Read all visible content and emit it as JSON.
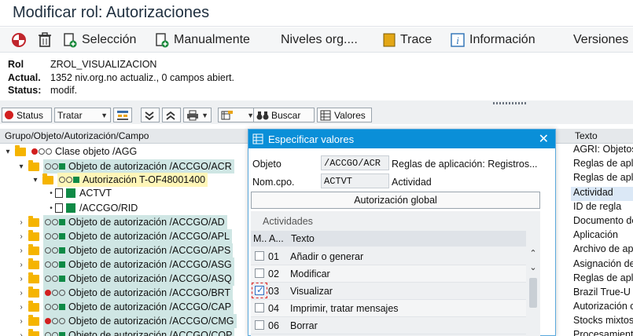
{
  "title": "Modificar rol: Autorizaciones",
  "toolbar": {
    "seleccion": "Selección",
    "manualmente": "Manualmente",
    "niveles": "Niveles org....",
    "trace": "Trace",
    "informacion": "Información",
    "versiones": "Versiones"
  },
  "info": {
    "rol_label": "Rol",
    "rol_value": "ZROL_VISUALIZACION",
    "actual_label": "Actual.",
    "actual_value": "1352 niv.org.no actualiz., 0 campos abiert.",
    "status_label": "Status:",
    "status_value": "modif."
  },
  "tree_toolbar": {
    "status": "Status",
    "tratar": "Tratar",
    "buscar": "Buscar",
    "valores": "Valores"
  },
  "tree_header": {
    "col1": "Grupo/Objeto/Autorización/Campo",
    "col2": "Texto"
  },
  "tree": {
    "class": "Clase objeto /AGG",
    "auth_objects": [
      "Objeto de autorización /ACCGO/ACR",
      "Objeto de autorización /ACCGO/AD",
      "Objeto de autorización /ACCGO/APL",
      "Objeto de autorización /ACCGO/APS",
      "Objeto de autorización /ACCGO/ASG",
      "Objeto de autorización /ACCGO/ASQ",
      "Objeto de autorización /ACCGO/BRT",
      "Objeto de autorización /ACCGO/CAP",
      "Objeto de autorización /ACCGO/CMG",
      "Objeto de autorización /ACCGO/COP"
    ],
    "authorization": "Autorización T-OF48001400",
    "fields": [
      "ACTVT",
      "/ACCGO/RID"
    ]
  },
  "right_texts": [
    "AGRI: Objetos",
    "Reglas de apl",
    "Reglas de apl",
    "Actividad",
    "ID de regla",
    "Documento de",
    "Aplicación",
    "Archivo de ap",
    "Asignación de",
    "Reglas de apl",
    "Brazil True-U",
    "Autorización c",
    "Stocks mixtos",
    "Procesamient"
  ],
  "dialog": {
    "title": "Especificar valores",
    "objeto_label": "Objeto",
    "objeto_value": "/ACCGO/ACR",
    "objeto_text": "Reglas de aplicación: Registros...",
    "nomcpo_label": "Nom.cpo.",
    "nomcpo_value": "ACTVT",
    "nomcpo_text": "Actividad",
    "global_button": "Autorización global",
    "panel_title": "Actividades",
    "col_m": "M..",
    "col_a": "A...",
    "col_texto": "Texto",
    "rows": [
      {
        "code": "01",
        "text": "Añadir o generar",
        "checked": false
      },
      {
        "code": "02",
        "text": "Modificar",
        "checked": false
      },
      {
        "code": "03",
        "text": "Visualizar",
        "checked": true
      },
      {
        "code": "04",
        "text": "Imprimir, tratar mensajes",
        "checked": false
      },
      {
        "code": "06",
        "text": "Borrar",
        "checked": false
      }
    ]
  }
}
